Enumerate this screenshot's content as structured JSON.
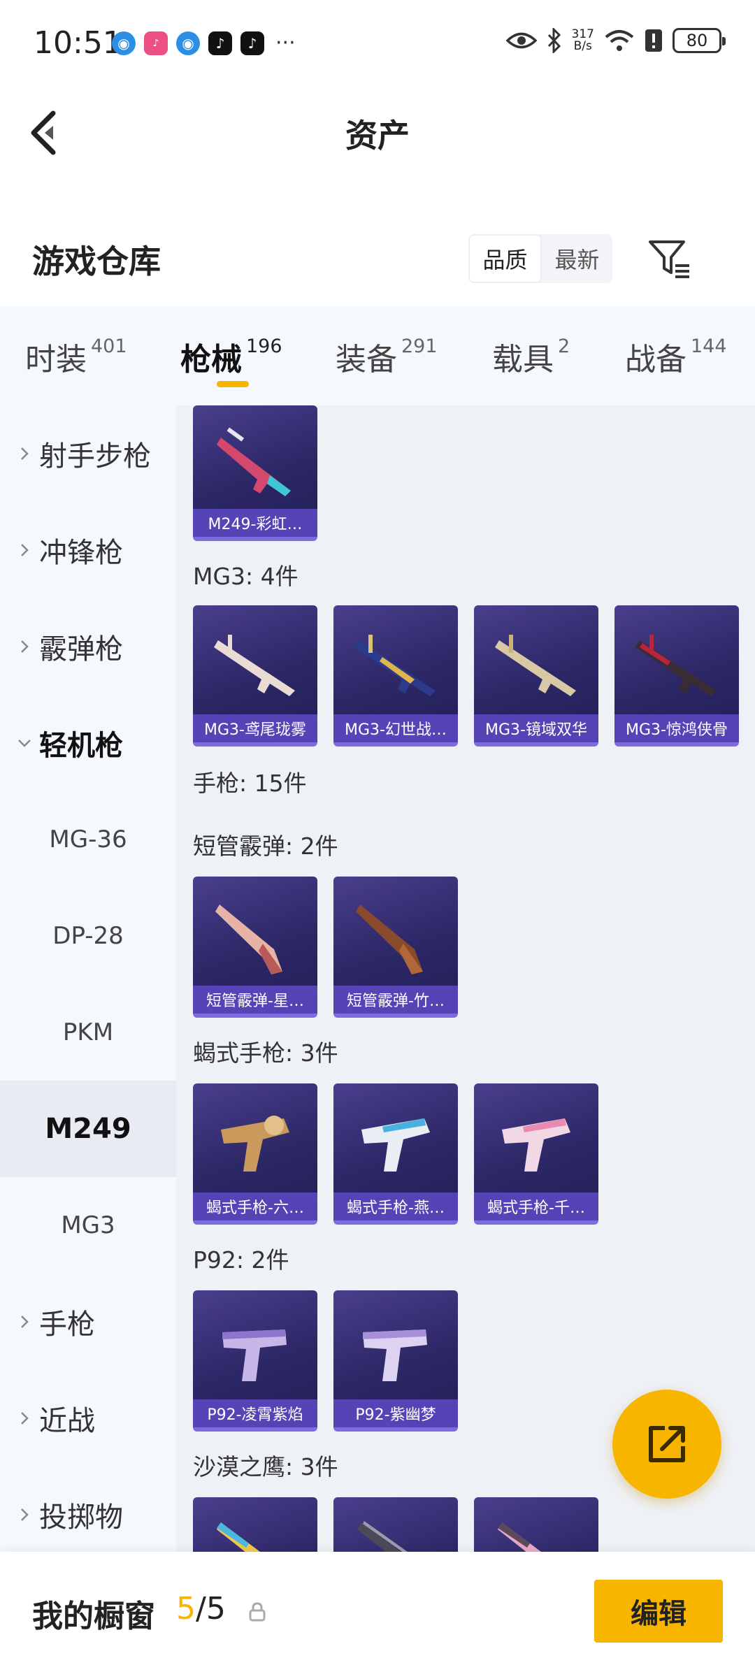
{
  "status_bar": {
    "time": "10:51",
    "net_speed_value": "317",
    "net_speed_unit": "B/s",
    "battery": "80",
    "more": "···"
  },
  "header": {
    "title": "资产"
  },
  "warehouse": {
    "title": "游戏仓库",
    "sort_options": [
      "品质",
      "最新"
    ],
    "sort_selected": "品质"
  },
  "tabs": [
    {
      "label": "时装",
      "count": "401"
    },
    {
      "label": "枪械",
      "count": "196"
    },
    {
      "label": "装备",
      "count": "291"
    },
    {
      "label": "载具",
      "count": "2"
    },
    {
      "label": "战备",
      "count": "144"
    }
  ],
  "active_tab": "枪械",
  "nav": {
    "items": [
      "射手步枪",
      "冲锋枪",
      "霰弹枪",
      "轻机枪"
    ],
    "subitems": [
      "MG-36",
      "DP-28",
      "PKM",
      "M249",
      "MG3"
    ],
    "more_items": [
      "手枪",
      "近战",
      "投掷物"
    ],
    "active_sub": "M249"
  },
  "groups": {
    "mg3_header": "MG3: 4件",
    "pistol_header": "手枪: 15件",
    "shortgun_header": "短管霰弹: 2件",
    "scorpion_header": "蝎式手枪: 3件",
    "p92_header": "P92: 2件",
    "deagle_header": "沙漠之鹰: 3件"
  },
  "items": {
    "m249": [
      "M249-彩虹…"
    ],
    "mg3": [
      "MG3-鸢尾珑雾",
      "MG3-幻世战…",
      "MG3-镜域双华",
      "MG3-惊鸿侠骨"
    ],
    "shortgun": [
      "短管霰弹-星…",
      "短管霰弹-竹…"
    ],
    "scorpion": [
      "蝎式手枪-六…",
      "蝎式手枪-燕…",
      "蝎式手枪-千…"
    ],
    "p92": [
      "P92-凌霄紫焰",
      "P92-紫幽梦"
    ]
  },
  "showcase": {
    "title": "我的橱窗",
    "current": "5",
    "total": "/5",
    "edit_label": "编辑"
  },
  "colors": {
    "accent": "#f7b500",
    "card_bg": "#2c2766",
    "card_caption": "#5a46be"
  },
  "icons": [
    "back-arrow-icon",
    "filter-icon",
    "chevron-right-icon",
    "chevron-down-icon",
    "share-external-icon",
    "lock-icon",
    "eye-icon",
    "bluetooth-icon",
    "wifi-icon",
    "alert-icon"
  ]
}
